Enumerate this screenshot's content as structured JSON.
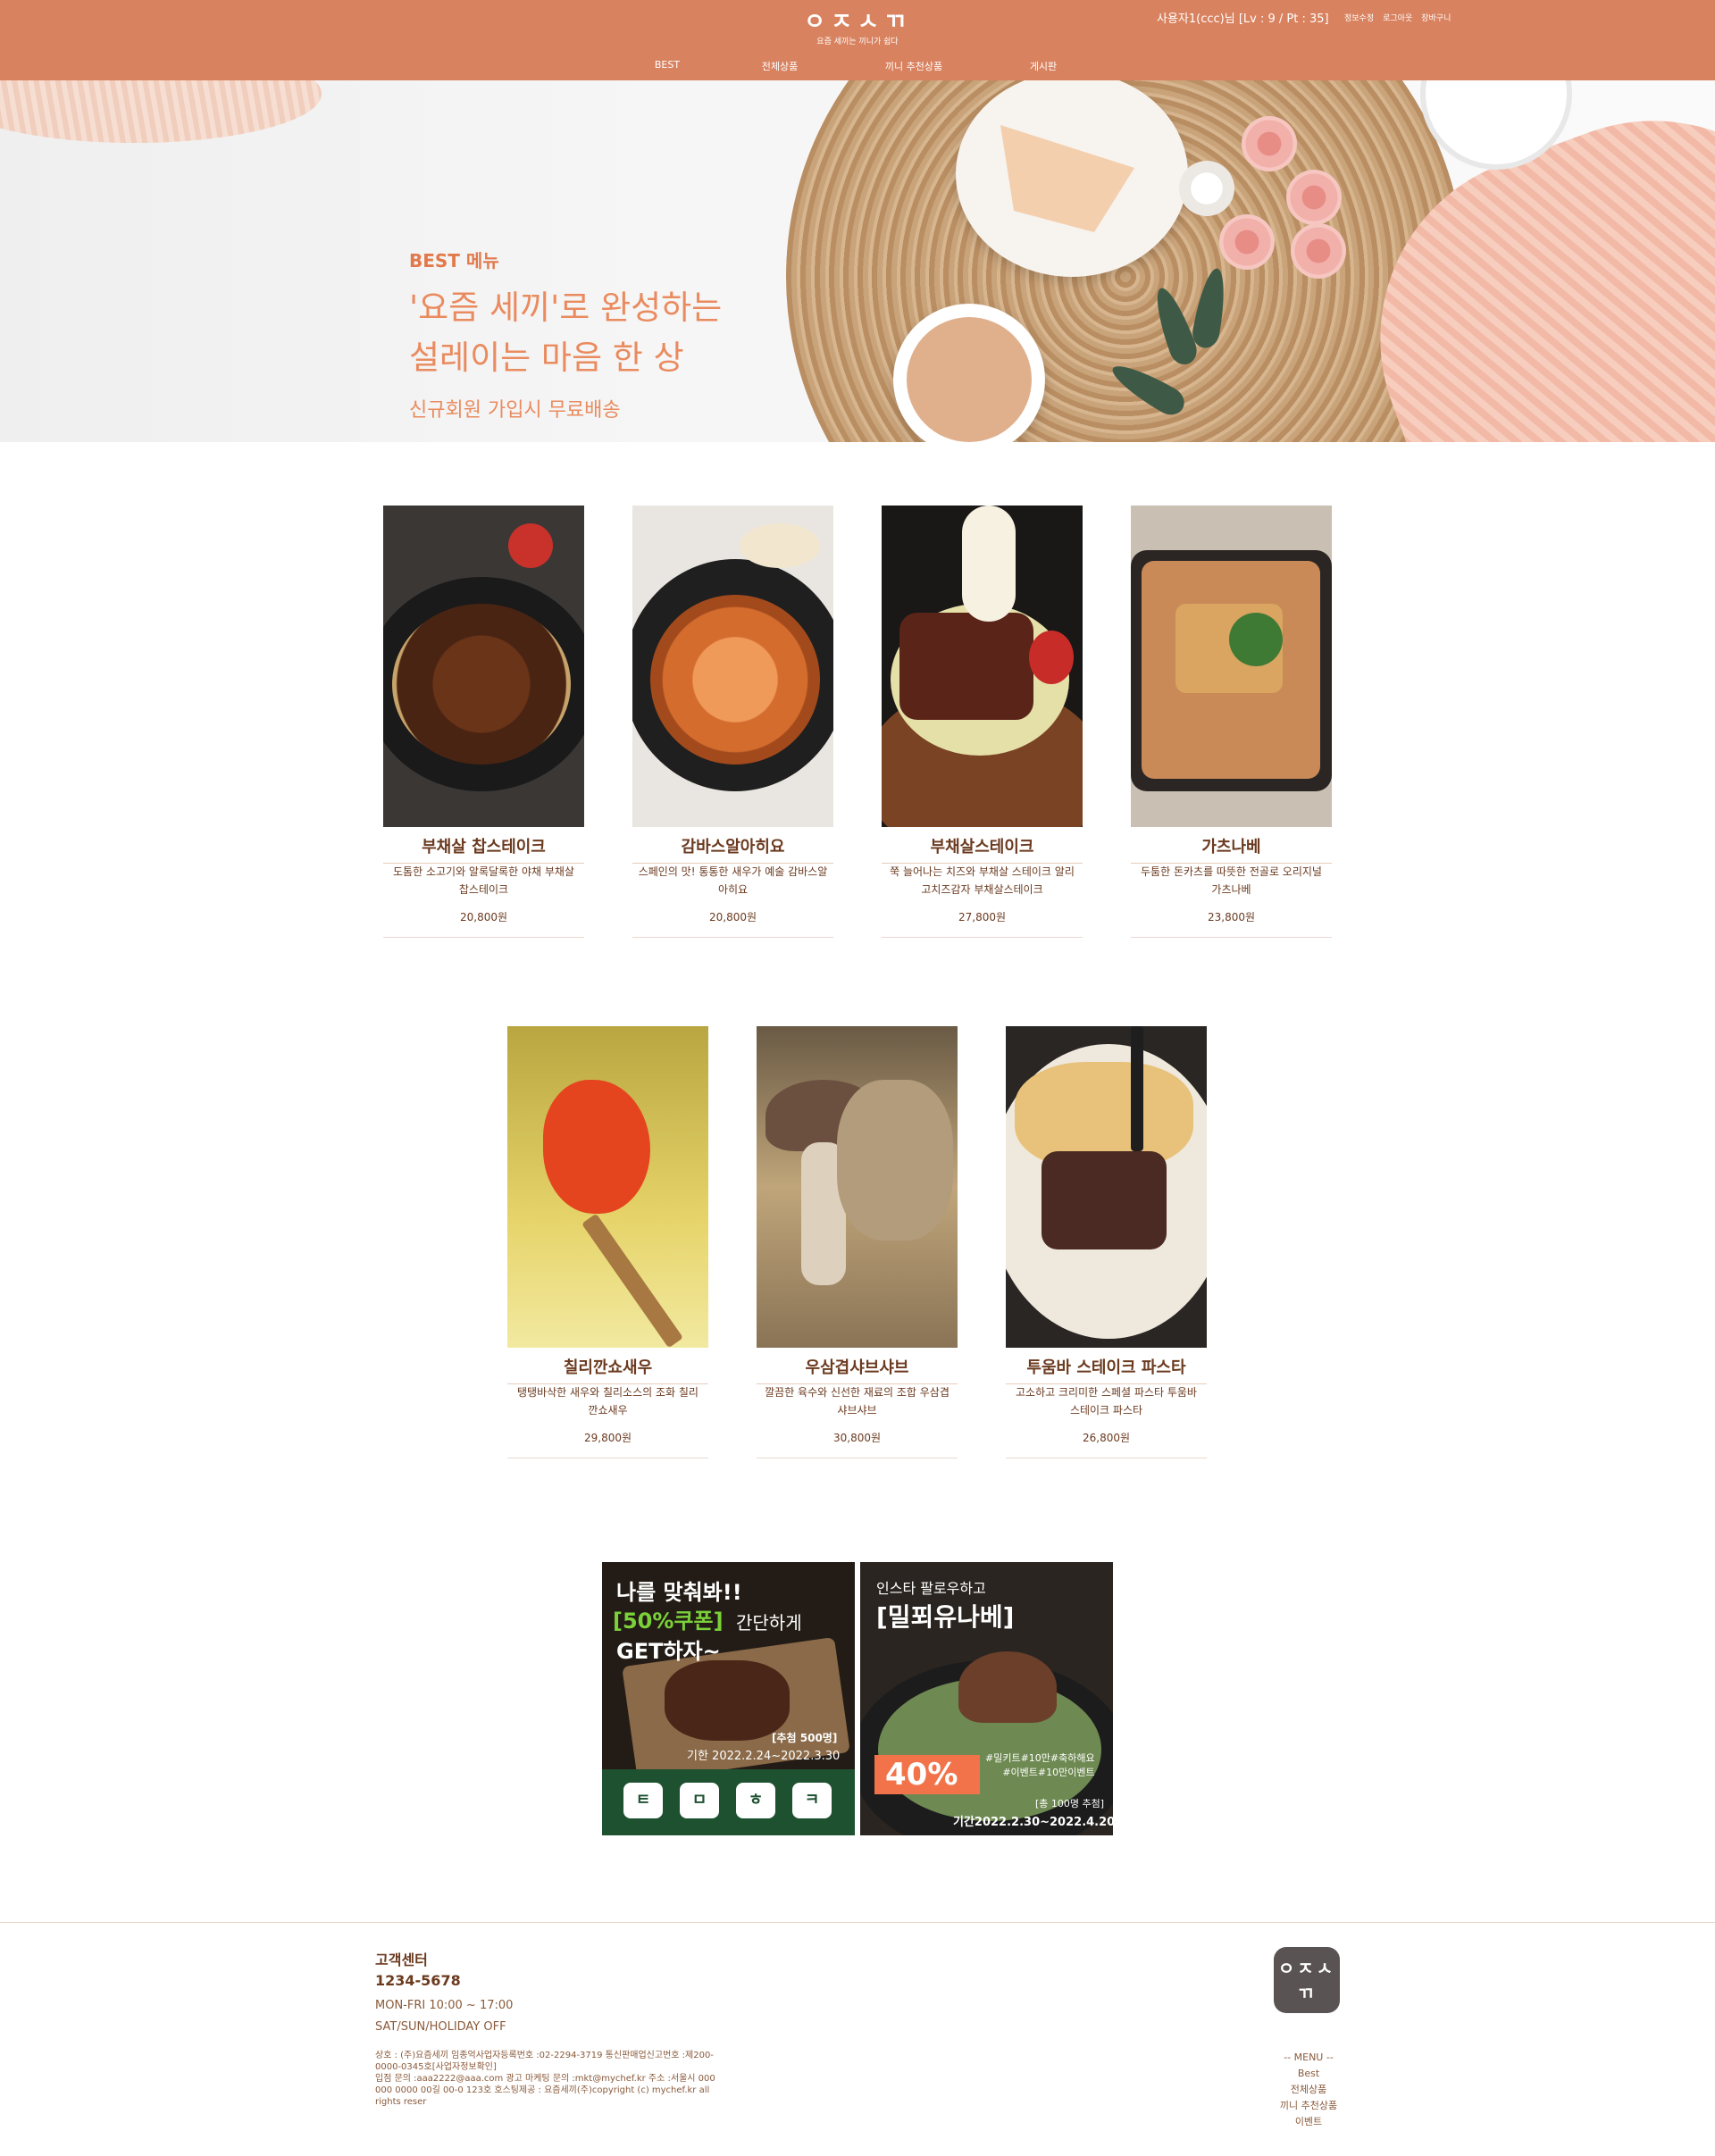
{
  "header": {
    "logo_text": "ㅇㅈㅅㄲ",
    "logo_sub": "요즘 세끼는 끼니가 쉽다",
    "user_info": "사용자1(ccc)님 [Lv : 9 / Pt : 35]",
    "util_links": [
      "정보수정",
      "로그아웃",
      "장바구니"
    ],
    "nav": [
      "BEST",
      "전체상품",
      "끼니 추천상품",
      "게시판"
    ],
    "bg_color": "#d9825f"
  },
  "hero": {
    "kicker": "BEST 메뉴",
    "title_line1": "'요즘 세끼'로 완성하는",
    "title_line2": "설레이는 마음 한 상",
    "subtitle": "신규회원 가입시 무료배송",
    "accent_color": "#ea8b5f"
  },
  "products": [
    {
      "name": "부채살 찹스테이크",
      "desc": "도톰한 소고기와 알록달록한 야채 부채살 찹스테이크",
      "price": "20,800원"
    },
    {
      "name": "감바스알아히요",
      "desc": "스페인의 맛! 통통한 새우가 예술 감바스알아히요",
      "price": "20,800원"
    },
    {
      "name": "부채살스테이크",
      "desc": "쭉 늘어나는 치즈와 부채살 스테이크 알리고치즈감자 부채살스테이크",
      "price": "27,800원"
    },
    {
      "name": "가츠나베",
      "desc": "두툼한 돈카츠를 따뜻한 전골로 오리지널 가츠나베",
      "price": "23,800원"
    },
    {
      "name": "칠리깐쇼새우",
      "desc": "탱탱바삭한 새우와 칠리소스의 조화 칠리깐쇼새우",
      "price": "29,800원"
    },
    {
      "name": "우삼겹샤브샤브",
      "desc": "깔끔한 육수와 신선한 재료의 조합 우삼겹샤브샤브",
      "price": "30,800원"
    },
    {
      "name": "투움바 스테이크 파스타",
      "desc": "고소하고 크리미한 스페셜 파스타 투움바 스테이크 파스타",
      "price": "26,800원"
    }
  ],
  "banners": {
    "a": {
      "line1": "나를 맞춰봐!!",
      "coupon": "[50%쿠폰]",
      "line2_rest": "간단하게",
      "line3": "GET하자~",
      "count": "[추첨 500명]",
      "period": "기한 2022.2.24~2022.3.30",
      "keys": [
        "ㅌ",
        "ㅁ",
        "ㅎ",
        "ㅋ"
      ]
    },
    "b": {
      "line1": "인스타 팔로우하고",
      "line2": "[밀푀유나베]",
      "discount": "40%",
      "tags": "#밀키트#10만#축하해요\n#이벤트#10만이벤트",
      "count": "[총 100명 추첨]",
      "period": "기간2022.2.30~2022.4.20"
    }
  },
  "footer": {
    "cs_title": "고객센터",
    "cs_phone": "1234-5678",
    "cs_hours1": "MON-FRI 10:00 ~ 17:00",
    "cs_hours2": "SAT/SUN/HOLIDAY OFF",
    "company_info": "상호 : (주)요즘세끼 임종억사업자등록번호 :02-2294-3719 통신판매업신고번호 :제200-0000-0345호[사업자정보확인]\n입점 문의 :aaa2222@aaa.com 광고 마케팅 문의 :mkt@mychef.kr 주소 :서울시 000 000 0000 00길 00-0 123호 호스팅제공 : 요즘세끼(주)copyright (c) mychef.kr all rights reser",
    "logo_text": "ㅇㅈㅅㄲ",
    "menu_title": "-- MENU --",
    "menu_items": [
      "Best",
      "전체상품",
      "끼니 추천상품",
      "이벤트"
    ]
  }
}
